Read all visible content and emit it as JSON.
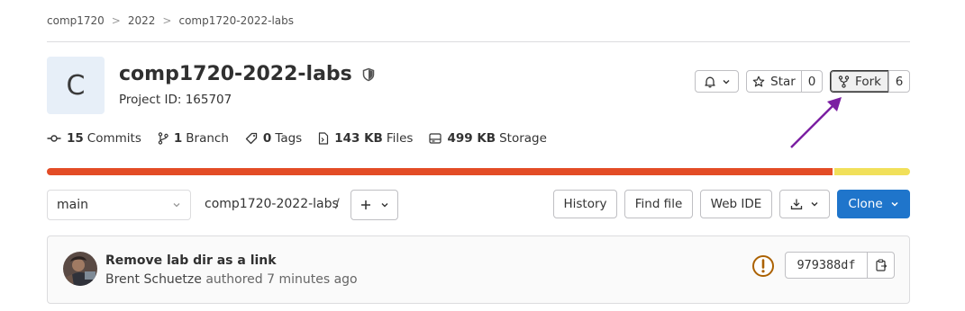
{
  "breadcrumb": [
    "comp1720",
    "2022",
    "comp1720-2022-labs"
  ],
  "breadcrumb_separator": ">",
  "project": {
    "avatar_letter": "C",
    "name": "comp1720-2022-labs",
    "id_text": "Project ID: 165707"
  },
  "actions": {
    "star_label": "Star",
    "star_count": "0",
    "fork_label": "Fork",
    "fork_count": "6"
  },
  "stats": [
    {
      "icon": "commit-icon",
      "value": "15",
      "label": "Commits"
    },
    {
      "icon": "branch-icon",
      "value": "1",
      "label": "Branch"
    },
    {
      "icon": "tag-icon",
      "value": "0",
      "label": "Tags"
    },
    {
      "icon": "file-icon",
      "value": "143 KB",
      "label": "Files"
    },
    {
      "icon": "storage-icon",
      "value": "499 KB",
      "label": "Storage"
    }
  ],
  "languages": [
    {
      "share": 0.912,
      "color": "#e34c26"
    },
    {
      "share": 0.088,
      "color": "#f1e05a"
    }
  ],
  "toolbar": {
    "branch": "main",
    "path": "comp1720-2022-labs",
    "path_sep": "/",
    "history": "History",
    "find_file": "Find file",
    "web_ide": "Web IDE",
    "clone": "Clone"
  },
  "commit": {
    "title": "Remove lab dir as a link",
    "author": "Brent Schuetze",
    "meta": "authored 7 minutes ago",
    "sha": "979388df"
  },
  "colors": {
    "accent": "#1f75cb",
    "annotation_arrow": "#7b1fa2",
    "warning": "#ab6100"
  }
}
